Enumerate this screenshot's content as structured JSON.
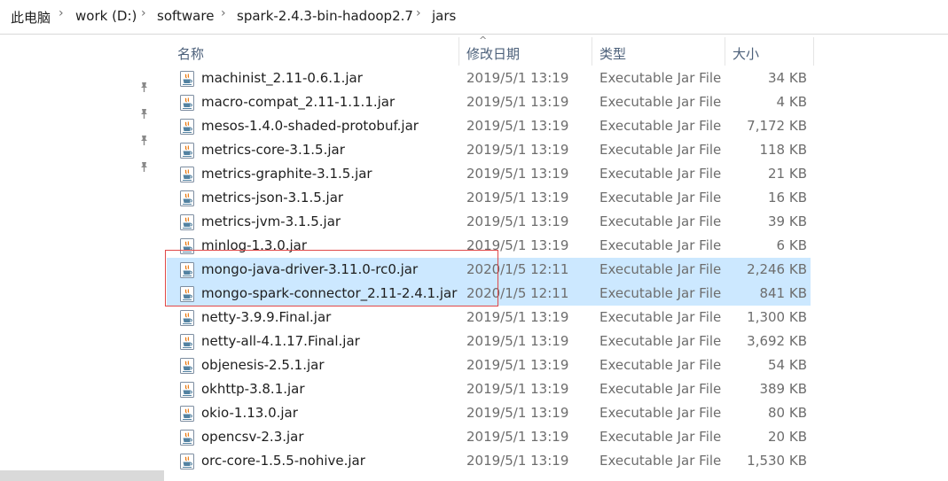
{
  "breadcrumb": {
    "items": [
      "此电脑",
      "work (D:)",
      "software",
      "spark-2.4.3-bin-hadoop2.7",
      "jars"
    ]
  },
  "columns": {
    "name": "名称",
    "date": "修改日期",
    "type": "类型",
    "size": "大小"
  },
  "files": [
    {
      "name": "machinist_2.11-0.6.1.jar",
      "date": "2019/5/1 13:19",
      "type": "Executable Jar File",
      "size": "34 KB",
      "selected": false
    },
    {
      "name": "macro-compat_2.11-1.1.1.jar",
      "date": "2019/5/1 13:19",
      "type": "Executable Jar File",
      "size": "4 KB",
      "selected": false
    },
    {
      "name": "mesos-1.4.0-shaded-protobuf.jar",
      "date": "2019/5/1 13:19",
      "type": "Executable Jar File",
      "size": "7,172 KB",
      "selected": false
    },
    {
      "name": "metrics-core-3.1.5.jar",
      "date": "2019/5/1 13:19",
      "type": "Executable Jar File",
      "size": "118 KB",
      "selected": false
    },
    {
      "name": "metrics-graphite-3.1.5.jar",
      "date": "2019/5/1 13:19",
      "type": "Executable Jar File",
      "size": "21 KB",
      "selected": false
    },
    {
      "name": "metrics-json-3.1.5.jar",
      "date": "2019/5/1 13:19",
      "type": "Executable Jar File",
      "size": "16 KB",
      "selected": false
    },
    {
      "name": "metrics-jvm-3.1.5.jar",
      "date": "2019/5/1 13:19",
      "type": "Executable Jar File",
      "size": "39 KB",
      "selected": false
    },
    {
      "name": "minlog-1.3.0.jar",
      "date": "2019/5/1 13:19",
      "type": "Executable Jar File",
      "size": "6 KB",
      "selected": false
    },
    {
      "name": "mongo-java-driver-3.11.0-rc0.jar",
      "date": "2020/1/5 12:11",
      "type": "Executable Jar File",
      "size": "2,246 KB",
      "selected": true
    },
    {
      "name": "mongo-spark-connector_2.11-2.4.1.jar",
      "date": "2020/1/5 12:11",
      "type": "Executable Jar File",
      "size": "841 KB",
      "selected": true
    },
    {
      "name": "netty-3.9.9.Final.jar",
      "date": "2019/5/1 13:19",
      "type": "Executable Jar File",
      "size": "1,300 KB",
      "selected": false
    },
    {
      "name": "netty-all-4.1.17.Final.jar",
      "date": "2019/5/1 13:19",
      "type": "Executable Jar File",
      "size": "3,692 KB",
      "selected": false
    },
    {
      "name": "objenesis-2.5.1.jar",
      "date": "2019/5/1 13:19",
      "type": "Executable Jar File",
      "size": "54 KB",
      "selected": false
    },
    {
      "name": "okhttp-3.8.1.jar",
      "date": "2019/5/1 13:19",
      "type": "Executable Jar File",
      "size": "389 KB",
      "selected": false
    },
    {
      "name": "okio-1.13.0.jar",
      "date": "2019/5/1 13:19",
      "type": "Executable Jar File",
      "size": "80 KB",
      "selected": false
    },
    {
      "name": "opencsv-2.3.jar",
      "date": "2019/5/1 13:19",
      "type": "Executable Jar File",
      "size": "20 KB",
      "selected": false
    },
    {
      "name": "orc-core-1.5.5-nohive.jar",
      "date": "2019/5/1 13:19",
      "type": "Executable Jar File",
      "size": "1,530 KB",
      "selected": false
    }
  ],
  "icons": {
    "breadcrumb_separator": "chevron-right-icon",
    "quick_access_pin": "pin-icon",
    "file": "java-jar-icon",
    "sort": "sort-up-icon"
  },
  "colors": {
    "selection": "#cce8ff",
    "highlight_box": "#e04848",
    "header_text": "#4c607a",
    "secondary_text": "#6d6d6d"
  }
}
